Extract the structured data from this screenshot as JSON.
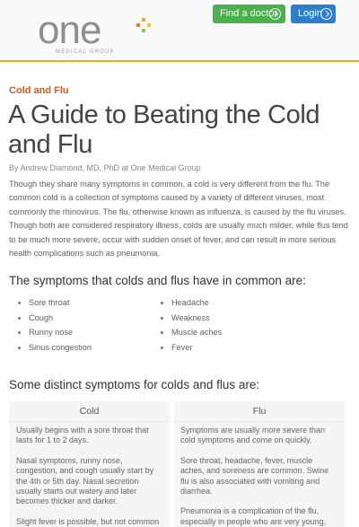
{
  "brand": {
    "logo_word": "one",
    "logo_sub": "MEDICAL GROUP",
    "logo_plus_colors": [
      "#f5a623",
      "#e8762c",
      "#8dc63f",
      "#f0c419"
    ]
  },
  "nav": {
    "find_doctor": "Find a doctor",
    "login": "Login",
    "find_color": "#4bb14c",
    "login_color": "#2d7fc9"
  },
  "article": {
    "category": "Cold and Flu",
    "title": "A Guide to Beating the Cold and Flu",
    "byline": "By Andrew Diamond, MD, PhD at One Medical Group",
    "intro": "Though they share many symptoms in common, a cold is very different from the flu. The common cold is a collection of symptoms caused by a variety of different viruses, most commonly the rhinovirus. The flu, otherwise known as influenza, is caused by the flu viruses. Though both are considered respiratory illness, colds are usually much milder, while flus tend to be much more severe, occur with sudden onset of fever, and can result in more serious health complications such as pneumonia.",
    "common_heading": "The symptoms that colds and flus have in common are:",
    "common_left": [
      "Sore throat",
      "Cough",
      "Runny nose",
      "Sinus congestion"
    ],
    "common_right": [
      "Headache",
      "Weakness",
      "Muscle aches",
      "Fever"
    ],
    "distinct_heading": "Some distinct symptoms for colds and flus are:",
    "cold": {
      "heading": "Cold",
      "paragraphs": [
        "Usually begins with a sore throat that lasts for 1 to 2 days.",
        "Nasal symptoms, runny nose, congestion, and cough usually start by the 4th or 5th day. Nasal secretion usually starts out watery and later becomes thicker and darker.",
        "Slight fever is possible, but not common in adults."
      ]
    },
    "flu": {
      "heading": "Flu",
      "paragraphs": [
        "Symptoms are usually more severe than cold symptoms and come on quickly.",
        "Sore throat, headache, fever, muscle aches, and soreness are common. Swine flu is also associated with vomiting and diarrhea.",
        "Pneumonia is a complication of the flu, especially in people who are very young, elderly, or have problems with their lungs"
      ]
    }
  }
}
